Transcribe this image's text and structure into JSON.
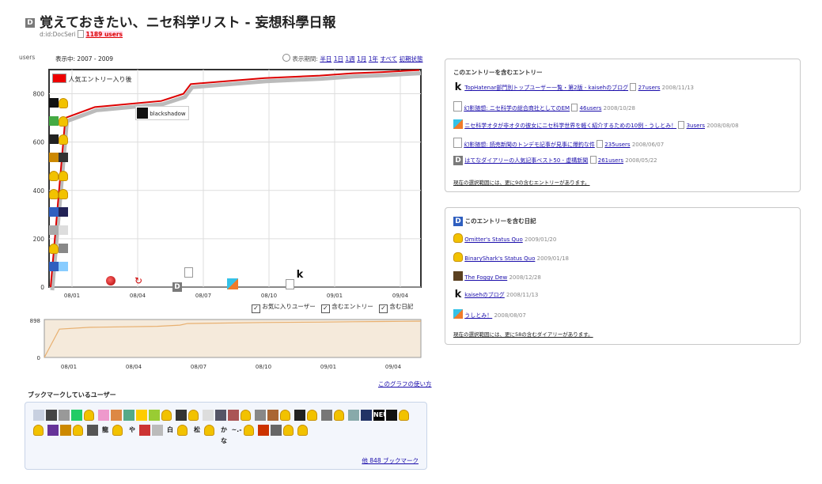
{
  "header": {
    "title": "覚えておきたい、ニセ科学リスト - 妄想科學日報",
    "author": "d:id:DocSeri",
    "user_count": "1189 users"
  },
  "chart": {
    "y_unit": "users",
    "display_range_label": "表示中:",
    "display_range": "2007 - 2009",
    "period_label": "表示期間:",
    "period_options": [
      "半日",
      "1日",
      "1週",
      "1月",
      "1年",
      "すべて",
      "初期状態"
    ],
    "legend_label": "人気エントリー入り後",
    "popular_user_label": "blackshadow",
    "main_y_ticks": [
      "800",
      "600",
      "400",
      "200",
      "0"
    ],
    "x_ticks": [
      "08/01",
      "08/04",
      "08/07",
      "08/10",
      "09/01",
      "09/04"
    ],
    "overview_y_ticks": [
      "898",
      "0"
    ],
    "toggles": [
      {
        "label": "お気に入りユーザー",
        "checked": true
      },
      {
        "label": "含むエントリー",
        "checked": true
      },
      {
        "label": "含む日記",
        "checked": true
      }
    ],
    "help_link": "このグラフの使い方",
    "colors": {
      "line": "#dd0000",
      "overview_fill": "#f5eadb",
      "overview_line": "#e8b070"
    }
  },
  "chart_data": {
    "type": "line",
    "xlabel": "",
    "ylabel": "users",
    "ylim": [
      0,
      900
    ],
    "x": [
      "07/12",
      "08/01",
      "08/02",
      "08/04",
      "08/06",
      "08/07",
      "08/10",
      "09/01",
      "09/03",
      "09/04",
      "09/05"
    ],
    "series": [
      {
        "values": [
          0,
          700,
          745,
          770,
          800,
          840,
          865,
          875,
          885,
          890,
          898
        ]
      }
    ]
  },
  "entries_panel": {
    "title": "このエントリーを含むエントリー",
    "items": [
      {
        "icon": "k",
        "title": "TopHatenar部門別トップユーザー一覧・第2版 - kaisehのブログ",
        "users": "27users",
        "date": "2008/11/13"
      },
      {
        "icon": "page",
        "title": "幻影随想: ニセ科学の総合商社としてのEM",
        "users": "46users",
        "date": "2008/10/28"
      },
      {
        "icon": "stripe",
        "title": "ニセ科学オタが非オタの彼女にニセ科学世界を軽く紹介するための10例 - うしとみ！",
        "users": "3users",
        "date": "2008/08/08"
      },
      {
        "icon": "page",
        "title": "幻影随想: 読売新聞のトンデモ記事が見事に爆釣な件",
        "users": "235users",
        "date": "2008/06/07"
      },
      {
        "icon": "d",
        "title": "はてなダイアリーの人気記事ベスト50 - 虚構新聞",
        "users": "261users",
        "date": "2008/05/22"
      }
    ],
    "more_text": "現在の選択範囲には、更に9の含むエントリーがあります。"
  },
  "diary_panel": {
    "title": "このエントリーを含む日記",
    "items": [
      {
        "icon": "user",
        "title": "Omitter's Status Quo",
        "date": "2009/01/20"
      },
      {
        "icon": "user",
        "title": "BinaryShark's Status Quo",
        "date": "2009/01/18"
      },
      {
        "icon": "photo",
        "title": "The Foggy Dew",
        "date": "2008/12/28"
      },
      {
        "icon": "k",
        "title": "kaisehのブログ",
        "date": "2008/11/13"
      },
      {
        "icon": "stripe",
        "title": "うしとみ！",
        "date": "2008/08/07"
      }
    ],
    "more_text": "現在の選択範囲には、更に58の含むダイアリーがあります。"
  },
  "bookmarks": {
    "title": "ブックマークしているユーザー",
    "more_link": "他 848 ブックマーク",
    "icon_texts": [
      "NEU!",
      "龍",
      "や",
      "白",
      "松",
      "かな",
      "~.-"
    ]
  }
}
